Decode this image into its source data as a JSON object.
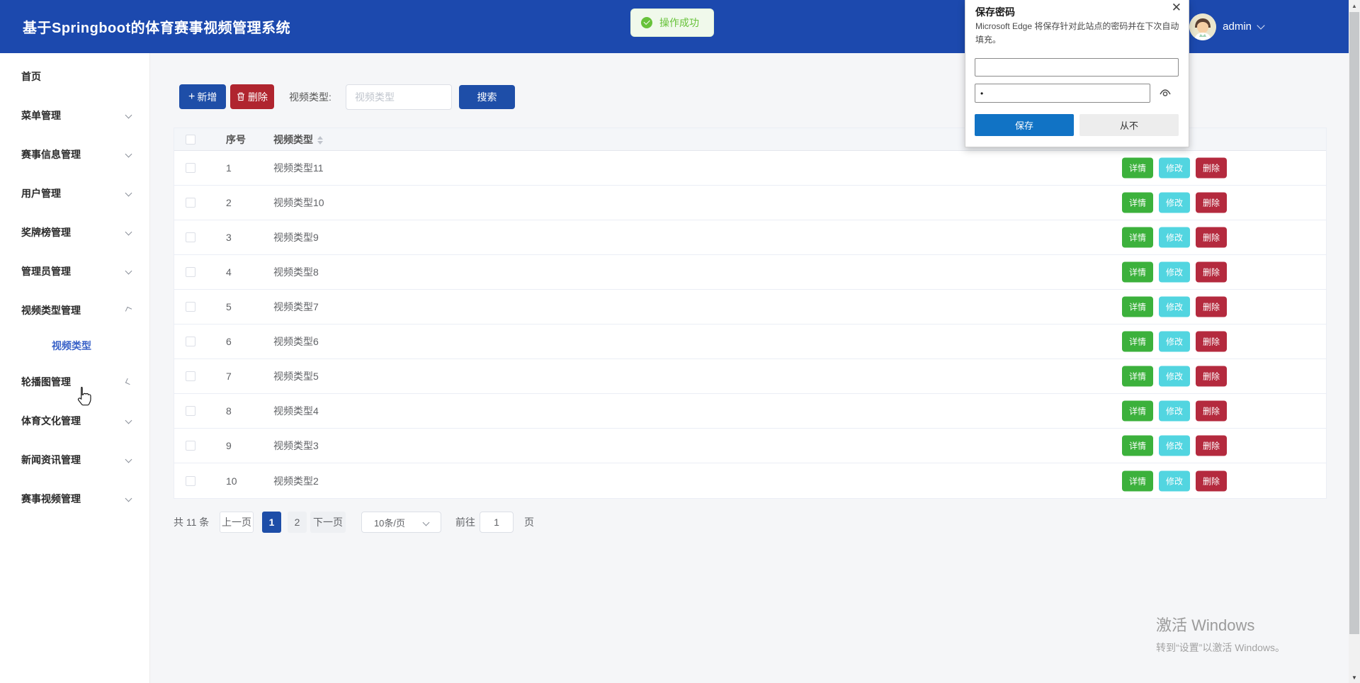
{
  "header": {
    "title": "基于Springboot的体育赛事视频管理系统",
    "username": "admin"
  },
  "toast": {
    "text": "操作成功"
  },
  "sidebar": {
    "items": [
      {
        "label": "首页",
        "kind": "top",
        "arrow": "none"
      },
      {
        "label": "菜单管理",
        "kind": "top",
        "arrow": "down"
      },
      {
        "label": "赛事信息管理",
        "kind": "top",
        "arrow": "down"
      },
      {
        "label": "用户管理",
        "kind": "top",
        "arrow": "down"
      },
      {
        "label": "奖牌榜管理",
        "kind": "top",
        "arrow": "down"
      },
      {
        "label": "管理员管理",
        "kind": "top",
        "arrow": "down"
      },
      {
        "label": "视频类型管理",
        "kind": "top",
        "arrow": "exp"
      },
      {
        "label": "视频类型",
        "kind": "sub",
        "arrow": "none"
      },
      {
        "label": "轮播图管理",
        "kind": "top",
        "arrow": "mid"
      },
      {
        "label": "体育文化管理",
        "kind": "top",
        "arrow": "down"
      },
      {
        "label": "新闻资讯管理",
        "kind": "top",
        "arrow": "down"
      },
      {
        "label": "赛事视频管理",
        "kind": "top",
        "arrow": "down"
      }
    ]
  },
  "toolbar": {
    "add_label": "新增",
    "delete_label": "删除",
    "filter_label": "视频类型:",
    "filter_placeholder": "视频类型",
    "search_label": "搜索"
  },
  "table": {
    "headers": {
      "index": "序号",
      "type": "视频类型"
    },
    "actions": {
      "detail": "详情",
      "edit": "修改",
      "del": "删除"
    },
    "rows": [
      {
        "index": "1",
        "type": "视频类型11"
      },
      {
        "index": "2",
        "type": "视频类型10"
      },
      {
        "index": "3",
        "type": "视频类型9"
      },
      {
        "index": "4",
        "type": "视频类型8"
      },
      {
        "index": "5",
        "type": "视频类型7"
      },
      {
        "index": "6",
        "type": "视频类型6"
      },
      {
        "index": "7",
        "type": "视频类型5"
      },
      {
        "index": "8",
        "type": "视频类型4"
      },
      {
        "index": "9",
        "type": "视频类型3"
      },
      {
        "index": "10",
        "type": "视频类型2"
      }
    ]
  },
  "pagination": {
    "total": "共 11 条",
    "prev": "上一页",
    "pages": [
      {
        "label": "1",
        "cls": "active"
      },
      {
        "label": "2",
        "cls": "plain"
      }
    ],
    "next": "下一页",
    "page_size": "10条/页",
    "goto_label": "前往",
    "goto_value": "1",
    "goto_suffix": "页"
  },
  "edge_dialog": {
    "title": "保存密码",
    "body": "Microsoft Edge 将保存针对此站点的密码并在下次自动填充。",
    "username_value": "",
    "password_value": "•",
    "save": "保存",
    "never": "从不"
  },
  "watermark": {
    "line1": "激活 Windows",
    "line2": "转到“设置”以激活 Windows。"
  },
  "colors": {
    "header_blue": "#1c49ae",
    "button_blue": "#1e4ea8",
    "button_red": "#b0252f",
    "action_green": "#3cb13c",
    "action_cyan": "#52d5e0",
    "action_red": "#b42a3e",
    "toast_green": "#67c23a",
    "toast_bg": "#f0f9eb",
    "edge_blue": "#1173c5",
    "link_blue": "#3b63c8"
  }
}
